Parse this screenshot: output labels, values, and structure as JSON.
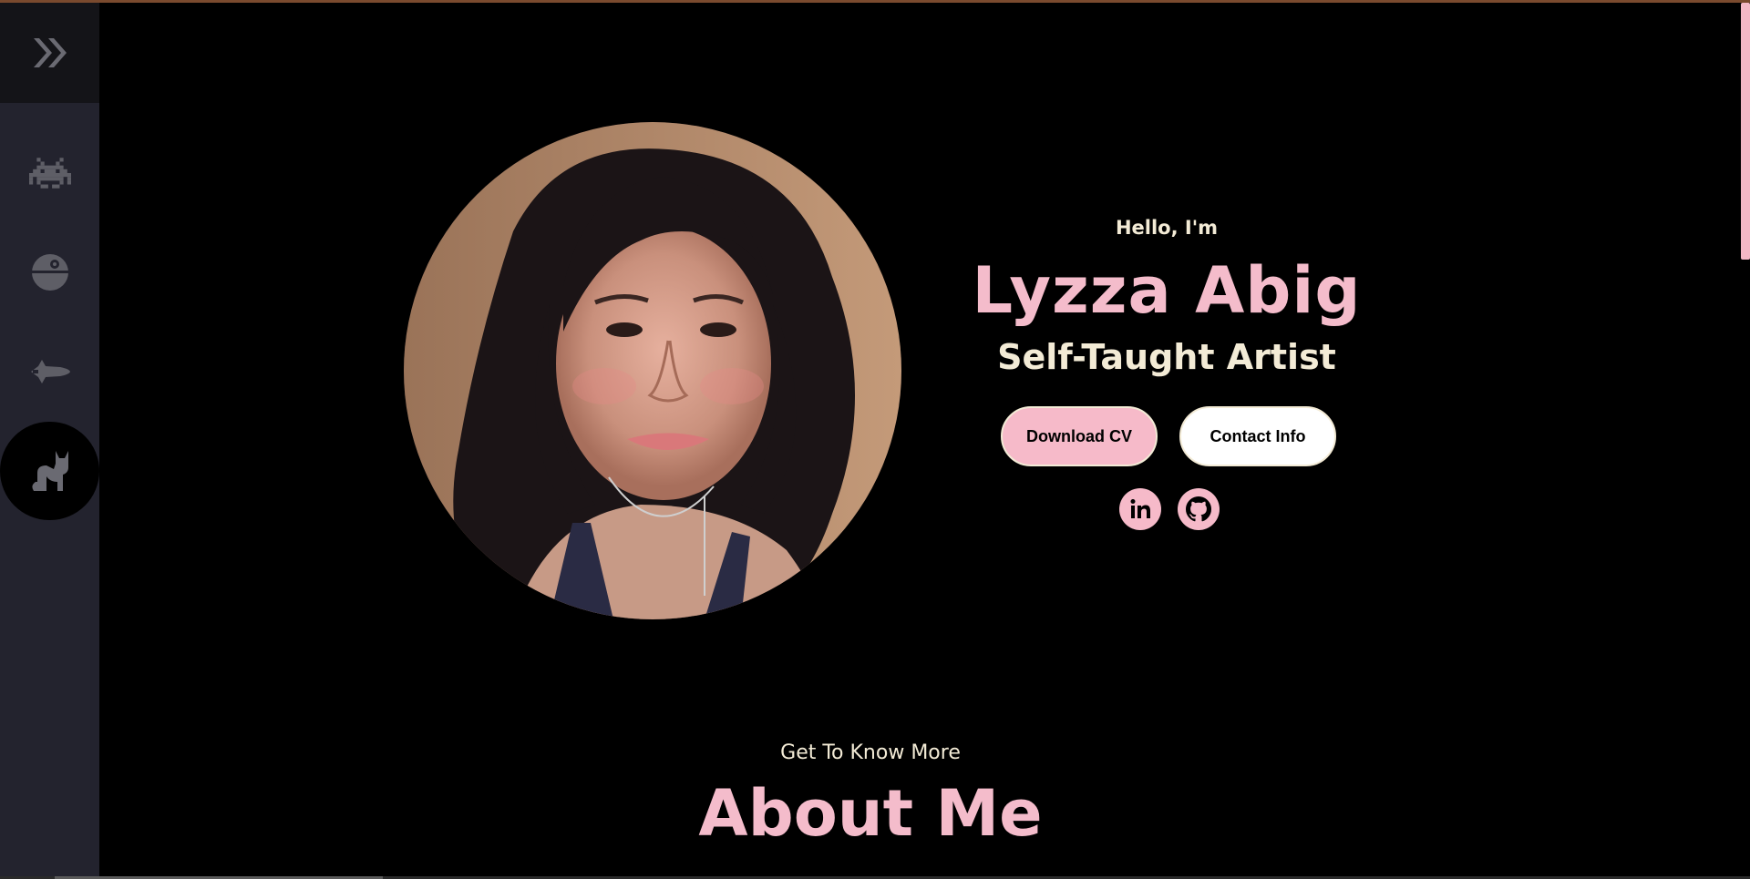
{
  "sidebar": {
    "toggle_icon": "double-chevron-right-icon",
    "items": [
      {
        "icon": "space-invader-icon",
        "active": false
      },
      {
        "icon": "death-star-icon",
        "active": false
      },
      {
        "icon": "space-shuttle-icon",
        "active": false
      },
      {
        "icon": "cat-icon",
        "active": true
      }
    ],
    "icon_color": "#5e5e66",
    "background": "#23232e"
  },
  "hero": {
    "greeting": "Hello, I'm",
    "name": "Lyzza Abig",
    "title": "Self-Taught Artist",
    "buttons": {
      "download_cv": "Download CV",
      "contact_info": "Contact Info"
    },
    "social": [
      {
        "icon": "linkedin-icon"
      },
      {
        "icon": "github-icon"
      }
    ]
  },
  "about": {
    "subtitle": "Get To Know More",
    "title": "About Me"
  },
  "colors": {
    "accent_pink": "#f4bccb",
    "cream": "#f3ebd6",
    "background": "#000000"
  }
}
